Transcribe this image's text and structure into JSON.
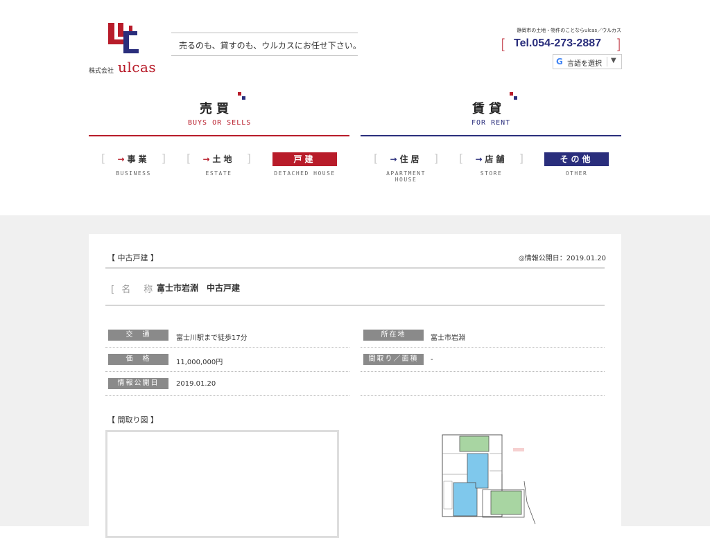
{
  "header": {
    "logo_company_prefix": "株式会社",
    "logo_name": "ulcas",
    "tagline": "売るのも、貸すのも、ウルカスにお任せ下さい。",
    "small_desc": "静岡市の土地・物件のことならulcas／ウルカス",
    "tel": "Tel.054-273-2887",
    "translate_g": "G",
    "translate_label": "言語を選択",
    "translate_arrow": "▼"
  },
  "sections": {
    "buy": {
      "title": "売買",
      "subtitle": "BUYS OR SELLS"
    },
    "rent": {
      "title": "賃貸",
      "subtitle": "FOR RENT"
    }
  },
  "nav": [
    {
      "label": "事業",
      "sub": "BUSINESS"
    },
    {
      "label": "土地",
      "sub": "ESTATE"
    },
    {
      "label": "戸建",
      "sub": "DETACHED HOUSE"
    },
    {
      "label": "住居",
      "sub": "APARTMENT HOUSE"
    },
    {
      "label": "店舗",
      "sub": "STORE"
    },
    {
      "label": "その他",
      "sub": "OTHER"
    }
  ],
  "nav_arrow": "→",
  "property": {
    "category": "【 中古戸建 】",
    "published": "◎情報公開日：2019.01.20",
    "name_label": "[ 名　称 ]",
    "name": "富士市岩淵　中古戸建",
    "rows_left": [
      {
        "label": "交　通",
        "value": "富士川駅まで徒歩17分"
      },
      {
        "label": "価　格",
        "value": "11,000,000円"
      },
      {
        "label": "情報公開日",
        "value": "2019.01.20"
      }
    ],
    "rows_right": [
      {
        "label": "所在地",
        "value": "富士市岩淵"
      },
      {
        "label": "間取り／面積",
        "value": "-"
      }
    ],
    "floorplan_title": "【 間取り図 】"
  },
  "colors": {
    "red": "#b81c2a",
    "navy": "#2a2e7c",
    "grey_label": "#8a8a8a",
    "bg": "#f0f0f0"
  }
}
